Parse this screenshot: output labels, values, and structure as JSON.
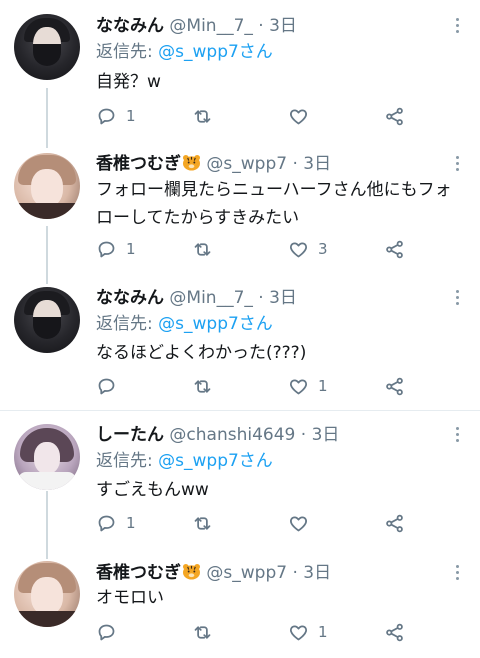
{
  "tweets": [
    {
      "name": "ななみん",
      "handle": "@Min__7_",
      "dot": "·",
      "time": "3日",
      "reply_prefix": "返信先:",
      "reply_to": "@s_wpp7さん",
      "text": "自発？w",
      "counts": {
        "reply": "1",
        "retweet": "",
        "like": ""
      }
    },
    {
      "name": "香椎つむぎ",
      "name_emoji": "tiger-emoji",
      "handle": "@s_wpp7",
      "dot": "·",
      "time": "3日",
      "text": "フォロー欄見たらニューハーフさん他にもフォローしてたからすきみたい",
      "counts": {
        "reply": "1",
        "retweet": "",
        "like": "3"
      }
    },
    {
      "name": "ななみん",
      "handle": "@Min__7_",
      "dot": "·",
      "time": "3日",
      "reply_prefix": "返信先:",
      "reply_to": "@s_wpp7さん",
      "text": "なるほどよくわかった(???)",
      "counts": {
        "reply": "",
        "retweet": "",
        "like": "1"
      }
    },
    {
      "name": "しーたん",
      "handle": "@chanshi4649",
      "dot": "·",
      "time": "3日",
      "reply_prefix": "返信先:",
      "reply_to": "@s_wpp7さん",
      "text": "すごえもんww",
      "counts": {
        "reply": "1",
        "retweet": "",
        "like": ""
      }
    },
    {
      "name": "香椎つむぎ",
      "name_emoji": "tiger-emoji",
      "handle": "@s_wpp7",
      "dot": "·",
      "time": "3日",
      "text": "オモロい",
      "counts": {
        "reply": "",
        "retweet": "",
        "like": "1"
      }
    }
  ],
  "colors": {
    "accent": "#1da1f2",
    "secondary_text": "#657786",
    "primary_text": "#14171a",
    "icon": "#657786",
    "thread_line": "#cfd9de",
    "separator": "#e6ecf0"
  },
  "icons": [
    "reply-icon",
    "retweet-icon",
    "like-icon",
    "share-icon",
    "more-icon",
    "tiger-emoji"
  ]
}
